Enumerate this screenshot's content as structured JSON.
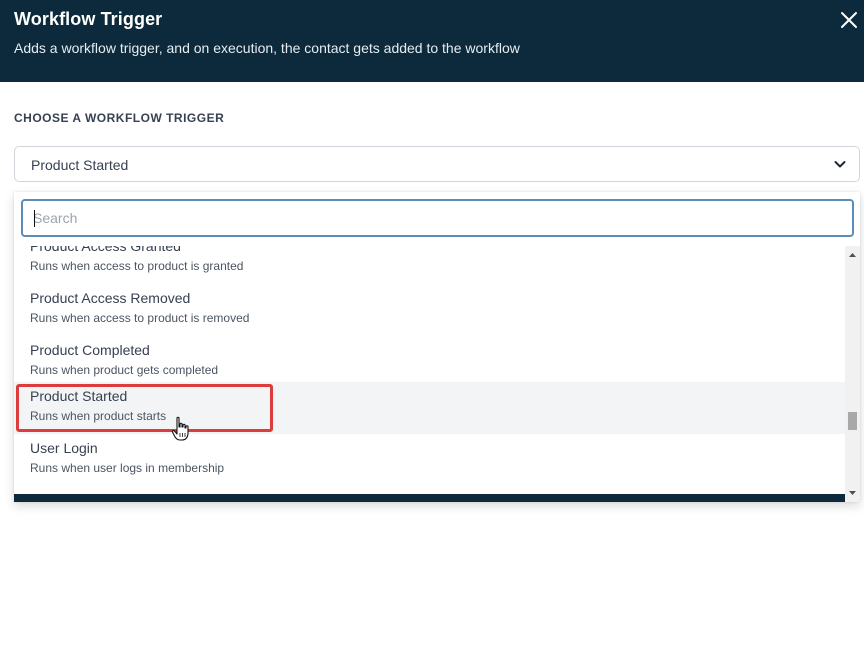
{
  "header": {
    "title": "Workflow Trigger",
    "subtitle": "Adds a workflow trigger, and on execution, the contact gets added to the workflow",
    "close_icon": "close-icon"
  },
  "form": {
    "section_label": "CHOOSE A WORKFLOW TRIGGER",
    "selected_value": "Product Started",
    "chevron_icon": "chevron-down-icon"
  },
  "dropdown": {
    "search_placeholder": "Search",
    "search_value": "",
    "items": [
      {
        "name": "Product Access Granted",
        "desc": "Runs when access to product is granted"
      },
      {
        "name": "Product Access Removed",
        "desc": "Runs when access to product is removed"
      },
      {
        "name": "Product Completed",
        "desc": "Runs when product gets completed"
      },
      {
        "name": "Product Started",
        "desc": "Runs when product starts"
      },
      {
        "name": "User Login",
        "desc": "Runs when user logs in membership"
      }
    ],
    "hovered_item": "Product Started"
  },
  "colors": {
    "header_bg": "#0c2a3b",
    "highlight": "#dc3c3c",
    "search_border": "#5b8db8",
    "hover_bg": "#f3f4f6"
  }
}
